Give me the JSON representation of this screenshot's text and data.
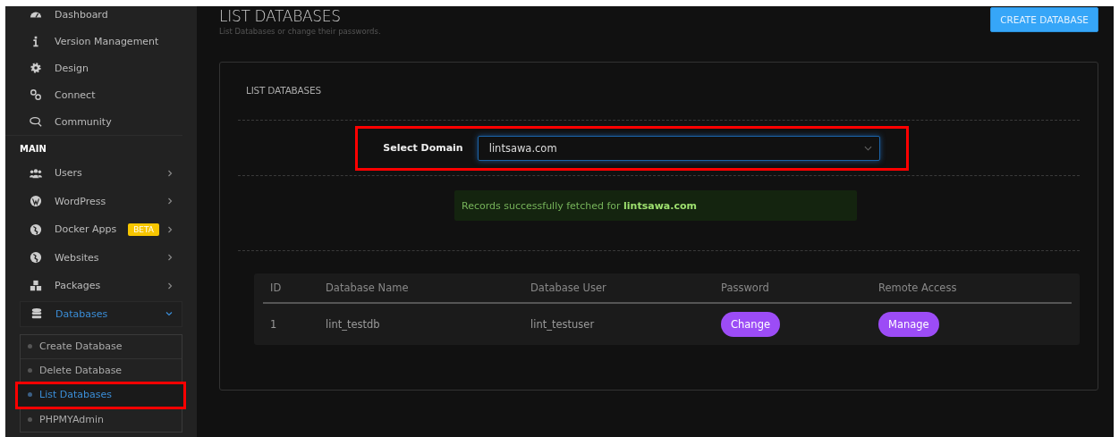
{
  "sidebar": {
    "top_items": [
      {
        "label": "Dashboard"
      },
      {
        "label": "Version Management"
      },
      {
        "label": "Design"
      },
      {
        "label": "Connect"
      },
      {
        "label": "Community"
      }
    ],
    "section_label": "MAIN",
    "main_items": [
      {
        "label": "Users",
        "expanded": false,
        "selected": false
      },
      {
        "label": "WordPress",
        "expanded": false,
        "selected": false
      },
      {
        "label": "Docker Apps",
        "expanded": false,
        "selected": false,
        "badge": "BETA"
      },
      {
        "label": "Websites",
        "expanded": false,
        "selected": false
      },
      {
        "label": "Packages",
        "expanded": false,
        "selected": false
      },
      {
        "label": "Databases",
        "expanded": true,
        "selected": true,
        "children": [
          {
            "label": "Create Database",
            "selected": false,
            "highlighted": false
          },
          {
            "label": "Delete Database",
            "selected": false,
            "highlighted": false
          },
          {
            "label": "List Databases",
            "selected": true,
            "highlighted": true
          },
          {
            "label": "PHPMYAdmin",
            "selected": false,
            "highlighted": false
          }
        ]
      }
    ]
  },
  "page": {
    "title": "LIST DATABASES",
    "subtitle": "List Databases or change their passwords.",
    "create_button": "CREATE DATABASE"
  },
  "card": {
    "title": "LIST DATABASES",
    "domain_label": "Select Domain",
    "domain_value": "lintsawa.com",
    "domain_highlighted": true,
    "alert": "Records successfully fetched for **lintsawa.com**",
    "table": {
      "columns": [
        "ID",
        "Database Name",
        "Database User",
        "Password",
        "Remote Access"
      ],
      "rows": [
        {
          "id": "1",
          "name": "lint_testdb",
          "user": "lint_testuser",
          "password_button": "Change",
          "remote_button": "Manage"
        }
      ]
    }
  }
}
